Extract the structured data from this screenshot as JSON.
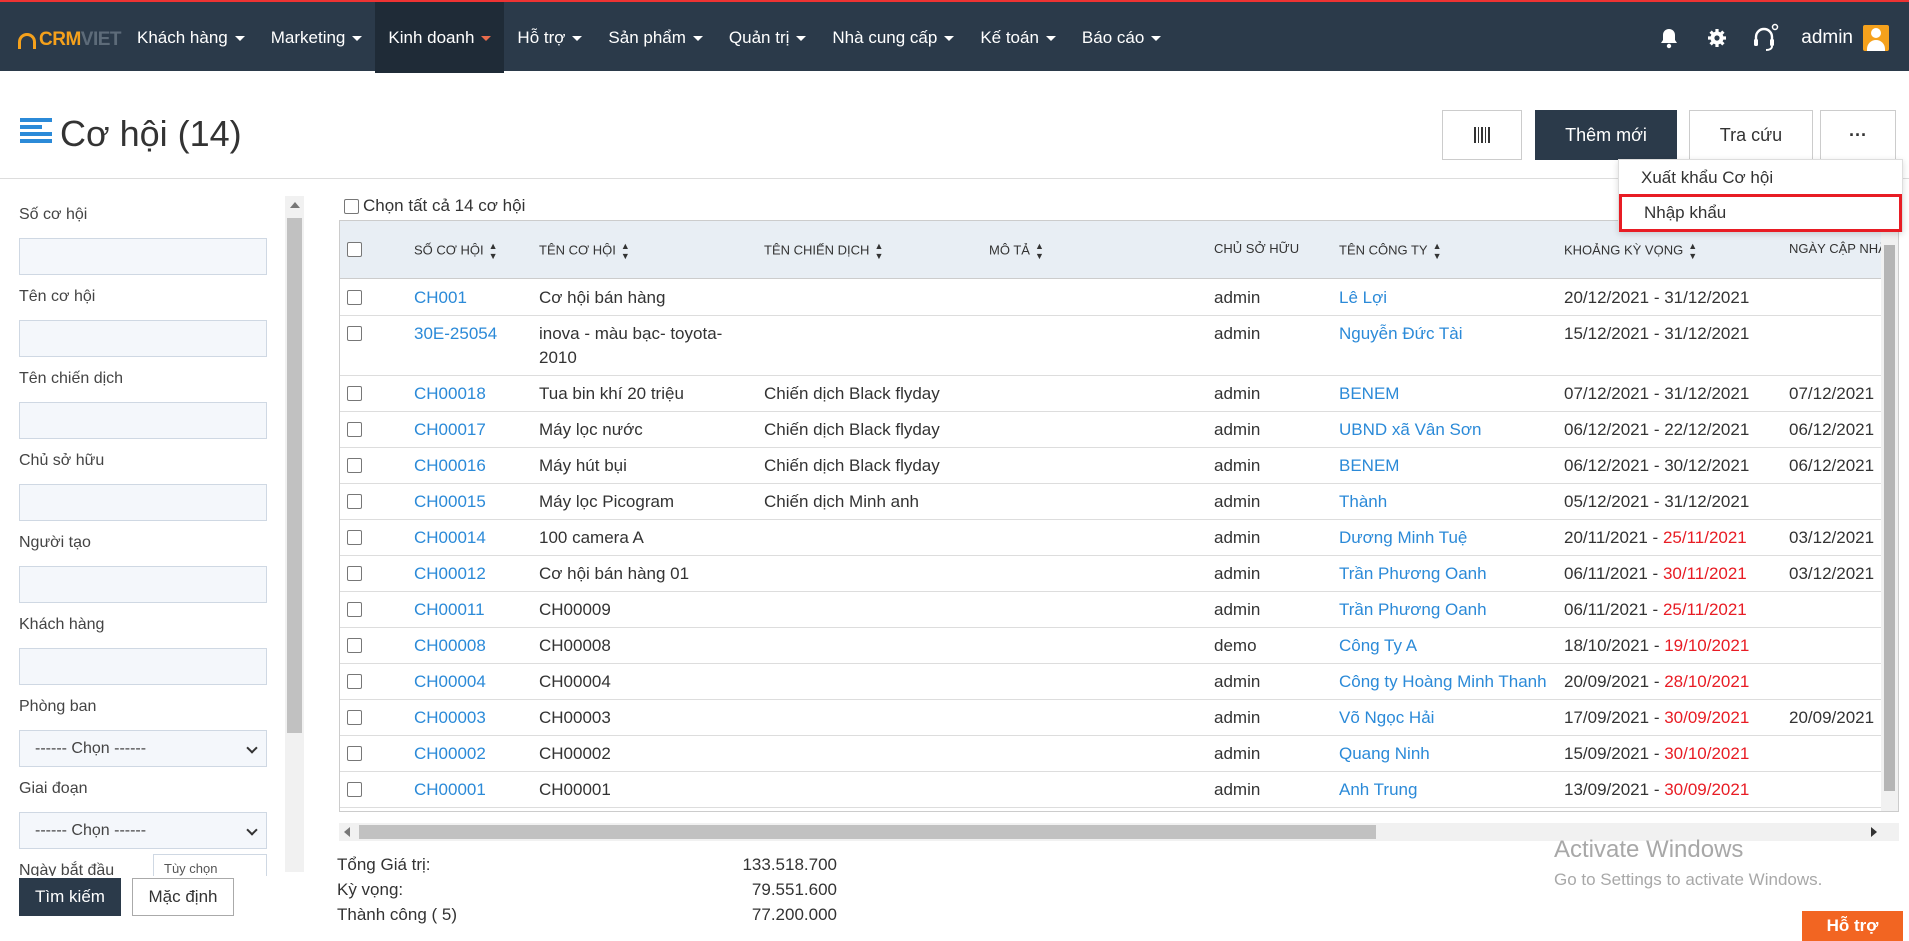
{
  "nav": {
    "logo_crm": "CRM",
    "logo_viet": "VIET",
    "menu": [
      {
        "label": "Khách hàng"
      },
      {
        "label": "Marketing"
      },
      {
        "label": "Kinh doanh"
      },
      {
        "label": "Hỗ trợ"
      },
      {
        "label": "Sản phẩm"
      },
      {
        "label": "Quản trị"
      },
      {
        "label": "Nhà cung cấp"
      },
      {
        "label": "Kế toán"
      },
      {
        "label": "Báo cáo"
      }
    ],
    "active_menu": "Kinh doanh",
    "icons": [
      "bell-icon",
      "gear-icon",
      "headset-icon"
    ],
    "user": "admin"
  },
  "header": {
    "title": "Cơ hội (14)",
    "add_label": "Thêm mới",
    "lookup_label": "Tra cứu",
    "more_label": "···"
  },
  "dropdown": {
    "export_label": "Xuất khẩu Cơ hội",
    "import_label": "Nhập khẩu"
  },
  "filters": {
    "so_co_hoi": "Số cơ hội",
    "ten_co_hoi": "Tên cơ hội",
    "ten_chien_dich": "Tên chiến dịch",
    "chu_so_huu": "Chủ sở hữu",
    "nguoi_tao": "Người tạo",
    "khach_hang": "Khách hàng",
    "phong_ban": "Phòng ban",
    "phong_ban_value": "------ Chọn ------",
    "giai_doan": "Giai đoạn",
    "giai_doan_value": "------ Chọn ------",
    "ngay_bat_dau": "Ngày bắt đầu",
    "ngay_bat_dau_value": "Tùy chọn",
    "search_label": "Tìm kiếm",
    "default_label": "Mặc định"
  },
  "table": {
    "select_all": "Chọn tất cả 14 cơ hội",
    "columns": [
      "SỐ CƠ HỘI",
      "TÊN CƠ HỘI",
      "TÊN CHIẾN DỊCH",
      "MÔ TẢ",
      "CHỦ SỞ HỮU",
      "TÊN CÔNG TY",
      "KHOẢNG KỲ VỌNG",
      "NGÀY CẬP NHẬT"
    ],
    "rows": [
      {
        "id": "CH001",
        "name": "Cơ hội bán hàng",
        "campaign": "",
        "owner": "admin",
        "company": "Lê Lợi",
        "start": "20/12/2021",
        "end": "31/12/2021",
        "end_overdue": false,
        "updated": ""
      },
      {
        "id": "30E-25054",
        "name": "inova - màu bạc- toyota-",
        "name2": "2010",
        "campaign": "",
        "owner": "admin",
        "company": "Nguyễn Đức Tài",
        "start": "15/12/2021",
        "end": "31/12/2021",
        "end_overdue": false,
        "updated": ""
      },
      {
        "id": "CH00018",
        "name": "Tua bin khí 20 triệu",
        "campaign": "Chiến dịch Black flyday",
        "owner": "admin",
        "company": "BENEM",
        "start": "07/12/2021",
        "end": "31/12/2021",
        "end_overdue": false,
        "updated": "07/12/2021"
      },
      {
        "id": "CH00017",
        "name": "Máy lọc nước",
        "campaign": "Chiến dịch Black flyday",
        "owner": "admin",
        "company": "UBND xã Vân Sơn",
        "start": "06/12/2021",
        "end": "22/12/2021",
        "end_overdue": false,
        "updated": "06/12/2021"
      },
      {
        "id": "CH00016",
        "name": "Máy hút bụi",
        "campaign": "Chiến dịch Black flyday",
        "owner": "admin",
        "company": "BENEM",
        "start": "06/12/2021",
        "end": "30/12/2021",
        "end_overdue": false,
        "updated": "06/12/2021"
      },
      {
        "id": "CH00015",
        "name": "Máy lọc Picogram",
        "campaign": "Chiến dịch Minh anh",
        "owner": "admin",
        "company": "Thành",
        "start": "05/12/2021",
        "end": "31/12/2021",
        "end_overdue": false,
        "updated": ""
      },
      {
        "id": "CH00014",
        "name": "100 camera A",
        "campaign": "",
        "owner": "admin",
        "company": "Dương Minh Tuệ",
        "start": "20/11/2021",
        "end": "25/11/2021",
        "end_overdue": true,
        "updated": "03/12/2021"
      },
      {
        "id": "CH00012",
        "name": "Cơ hội bán hàng 01",
        "campaign": "",
        "owner": "admin",
        "company": "Trần Phương Oanh",
        "start": "06/11/2021",
        "end": "30/11/2021",
        "end_overdue": true,
        "updated": "03/12/2021"
      },
      {
        "id": "CH00011",
        "name": "CH00009",
        "campaign": "",
        "owner": "admin",
        "company": "Trần Phương Oanh",
        "start": "06/11/2021",
        "end": "25/11/2021",
        "end_overdue": true,
        "updated": ""
      },
      {
        "id": "CH00008",
        "name": "CH00008",
        "campaign": "",
        "owner": "demo",
        "company": "Công Ty A",
        "start": "18/10/2021",
        "end": "19/10/2021",
        "end_overdue": true,
        "updated": ""
      },
      {
        "id": "CH00004",
        "name": "CH00004",
        "campaign": "",
        "owner": "admin",
        "company": "Công ty Hoàng Minh Thanh",
        "start": "20/09/2021",
        "end": "28/10/2021",
        "end_overdue": true,
        "updated": ""
      },
      {
        "id": "CH00003",
        "name": "CH00003",
        "campaign": "",
        "owner": "admin",
        "company": "Võ Ngọc Hải",
        "start": "17/09/2021",
        "end": "30/09/2021",
        "end_overdue": true,
        "updated": "20/09/2021"
      },
      {
        "id": "CH00002",
        "name": "CH00002",
        "campaign": "",
        "owner": "admin",
        "company": "Quang Ninh",
        "start": "15/09/2021",
        "end": "30/10/2021",
        "end_overdue": true,
        "updated": ""
      },
      {
        "id": "CH00001",
        "name": "CH00001",
        "campaign": "",
        "owner": "admin",
        "company": "Anh Trung",
        "start": "13/09/2021",
        "end": "30/09/2021",
        "end_overdue": true,
        "updated": ""
      }
    ]
  },
  "totals": {
    "tong_label": "Tổng Giá trị:",
    "tong_value": "133.518.700",
    "ky_vong_label": "Kỳ vọng:",
    "ky_vong_value": "79.551.600",
    "thanh_cong_label": "Thành công ( 5)",
    "thanh_cong_value": "77.200.000"
  },
  "watermark": {
    "line1": "Activate Windows",
    "line2": "Go to Settings to activate Windows."
  },
  "help_label": "Hỗ trợ"
}
